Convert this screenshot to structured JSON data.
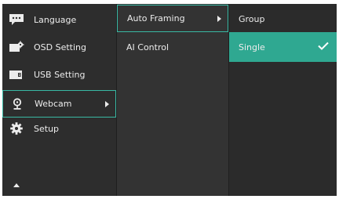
{
  "main_menu": {
    "items": [
      {
        "label": "Language",
        "icon": "language-icon"
      },
      {
        "label": "OSD Setting",
        "icon": "osd-setting-icon"
      },
      {
        "label": "USB Setting",
        "icon": "usb-setting-icon"
      },
      {
        "label": "Webcam",
        "icon": "webcam-icon",
        "state": "active"
      },
      {
        "label": "Setup",
        "icon": "setup-gear-icon"
      }
    ]
  },
  "submenu": {
    "items": [
      {
        "label": "Auto Framing",
        "state": "active"
      },
      {
        "label": "AI Control"
      }
    ]
  },
  "options": {
    "items": [
      {
        "label": "Group"
      },
      {
        "label": "Single",
        "state": "selected"
      }
    ]
  },
  "colors": {
    "accent": "#39b9a4",
    "selected_bg": "#2fa891",
    "panel_bg": "#2e2e2e",
    "text": "#ececec"
  }
}
